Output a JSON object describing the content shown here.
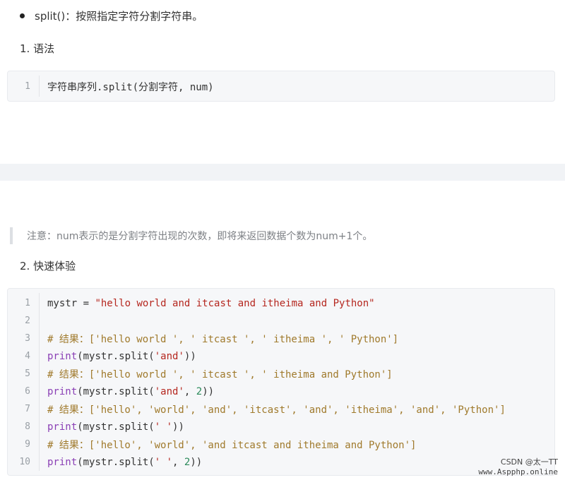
{
  "top": {
    "bullet_text": "split()：按照指定字符分割字符串。",
    "heading1": "1. 语法",
    "syntax_code": {
      "line_no": "1",
      "text": "字符串序列.split(分割字符, num)"
    }
  },
  "note": "注意：num表示的是分割字符出现的次数，即将来返回数据个数为num+1个。",
  "heading2": "2. 快速体验",
  "example_code": [
    {
      "n": "1",
      "parts": [
        {
          "t": "mystr = ",
          "c": "plain"
        },
        {
          "t": "\"hello world and itcast and itheima and Python\"",
          "c": "str"
        }
      ]
    },
    {
      "n": "2",
      "parts": []
    },
    {
      "n": "3",
      "parts": [
        {
          "t": "# 结果：['hello world ', ' itcast ', ' itheima ', ' Python']",
          "c": "cmt"
        }
      ]
    },
    {
      "n": "4",
      "parts": [
        {
          "t": "print",
          "c": "kw"
        },
        {
          "t": "(mystr.split(",
          "c": "plain"
        },
        {
          "t": "'and'",
          "c": "str"
        },
        {
          "t": "))",
          "c": "plain"
        }
      ]
    },
    {
      "n": "5",
      "parts": [
        {
          "t": "# 结果：['hello world ', ' itcast ', ' itheima and Python']",
          "c": "cmt"
        }
      ]
    },
    {
      "n": "6",
      "parts": [
        {
          "t": "print",
          "c": "kw"
        },
        {
          "t": "(mystr.split(",
          "c": "plain"
        },
        {
          "t": "'and'",
          "c": "str"
        },
        {
          "t": ", ",
          "c": "plain"
        },
        {
          "t": "2",
          "c": "num"
        },
        {
          "t": "))",
          "c": "plain"
        }
      ]
    },
    {
      "n": "7",
      "parts": [
        {
          "t": "# 结果：['hello', 'world', 'and', 'itcast', 'and', 'itheima', 'and', 'Python']",
          "c": "cmt"
        }
      ]
    },
    {
      "n": "8",
      "parts": [
        {
          "t": "print",
          "c": "kw"
        },
        {
          "t": "(mystr.split(",
          "c": "plain"
        },
        {
          "t": "' '",
          "c": "str"
        },
        {
          "t": "))",
          "c": "plain"
        }
      ]
    },
    {
      "n": "9",
      "parts": [
        {
          "t": "# 结果：['hello', 'world', 'and itcast and itheima and Python']",
          "c": "cmt"
        }
      ]
    },
    {
      "n": "10",
      "parts": [
        {
          "t": "print",
          "c": "kw"
        },
        {
          "t": "(mystr.split(",
          "c": "plain"
        },
        {
          "t": "' '",
          "c": "str"
        },
        {
          "t": ", ",
          "c": "plain"
        },
        {
          "t": "2",
          "c": "num"
        },
        {
          "t": "))",
          "c": "plain"
        }
      ]
    }
  ],
  "watermark": {
    "line1": "CSDN @太一TT",
    "line2": "www.Aspphp.online"
  }
}
